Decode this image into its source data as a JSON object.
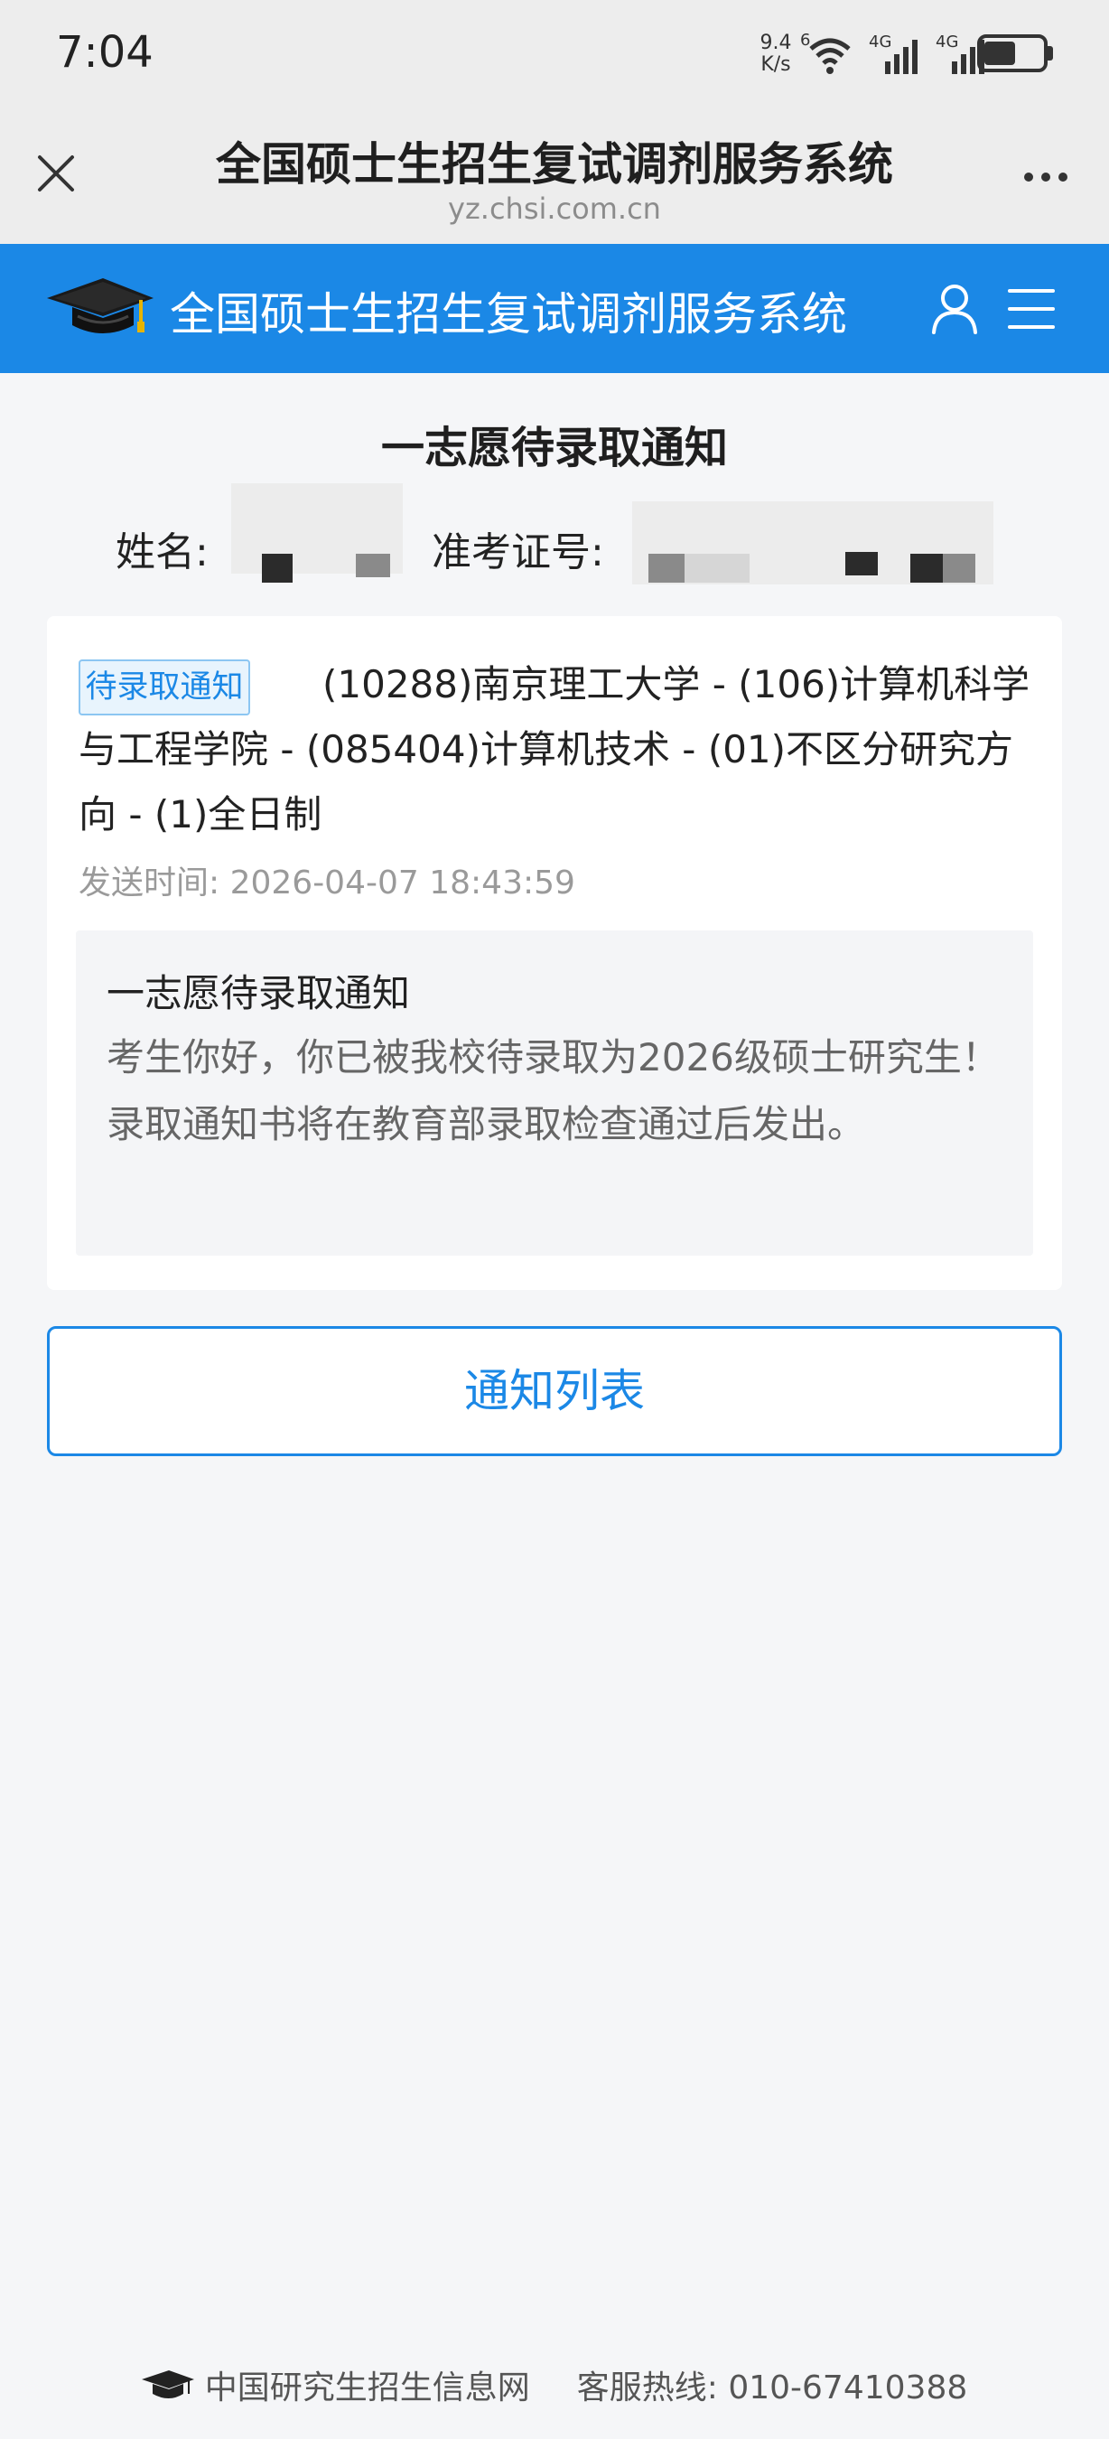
{
  "status_bar": {
    "time": "7:04",
    "net_speed_value": "9.4",
    "net_speed_unit": "K/s",
    "wifi_label": "6",
    "signal1_label": "4G",
    "signal2_label": "4G"
  },
  "webview": {
    "title": "全国硕士生招生复试调剂服务系统",
    "domain": "yz.chsi.com.cn"
  },
  "site_header": {
    "title": "全国硕士生招生复试调剂服务系统"
  },
  "page": {
    "title": "一志愿待录取通知",
    "name_label": "姓名:",
    "exam_id_label": "准考证号:"
  },
  "notice": {
    "tag": "待录取通知",
    "description": "(10288)南京理工大学 - (106)计算机科学与工程学院 - (085404)计算机技术 - (01)不区分研究方向 - (1)全日制",
    "send_time": "发送时间: 2026-04-07 18:43:59",
    "message_title": "一志愿待录取通知",
    "message_body": "考生你好，你已被我校待录取为2026级硕士研究生！录取通知书将在教育部录取检查通过后发出。"
  },
  "actions": {
    "list_button": "通知列表"
  },
  "footer": {
    "site_name": "中国研究生招生信息网",
    "hotline": "客服热线: 010-67410388"
  },
  "colors": {
    "brand_blue": "#1b88e6",
    "background": "#f5f6f8",
    "status_bar_bg": "#ededed"
  },
  "icons": {
    "close": "close-icon",
    "more": "more-icon",
    "logo": "graduation-cap-icon",
    "user": "user-icon",
    "menu": "menu-icon"
  }
}
